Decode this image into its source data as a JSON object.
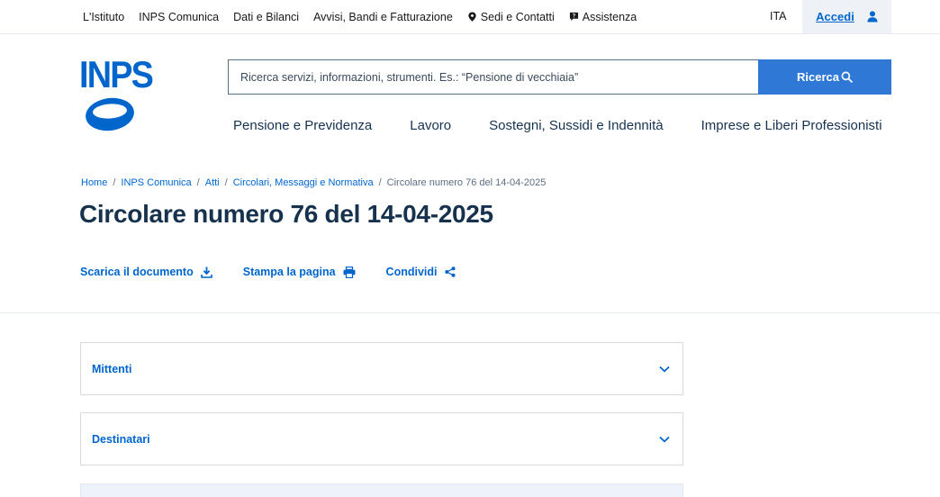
{
  "top_nav": {
    "items": [
      {
        "label": "L'Istituto"
      },
      {
        "label": "INPS Comunica"
      },
      {
        "label": "Dati e Bilanci"
      },
      {
        "label": "Avvisi, Bandi e Fatturazione"
      },
      {
        "label": "Sedi e Contatti",
        "icon": "map-pin-icon"
      },
      {
        "label": "Assistenza",
        "icon": "chat-help-icon"
      }
    ],
    "language": "ITA",
    "login_label": "Accedi",
    "login_icon": "user-icon"
  },
  "header": {
    "logo_text": "INPS",
    "search": {
      "placeholder": "Ricerca servizi, informazioni, strumenti. Es.: “Pensione di vecchiaia”",
      "button_label": "Ricerca",
      "button_icon": "search-icon"
    },
    "main_nav": [
      {
        "label": "Pensione e Previdenza"
      },
      {
        "label": "Lavoro"
      },
      {
        "label": "Sostegni, Sussidi e Indennità"
      },
      {
        "label": "Imprese e Liberi Professionisti"
      }
    ]
  },
  "breadcrumb": {
    "items": [
      {
        "label": "Home"
      },
      {
        "label": "INPS Comunica"
      },
      {
        "label": "Atti"
      },
      {
        "label": "Circolari, Messaggi e Normativa"
      }
    ],
    "current": "Circolare numero 76 del 14-04-2025"
  },
  "page": {
    "title": "Circolare numero 76 del 14-04-2025",
    "actions": [
      {
        "label": "Scarica il documento",
        "icon": "download-icon"
      },
      {
        "label": "Stampa la pagina",
        "icon": "print-icon"
      },
      {
        "label": "Condividi",
        "icon": "share-icon"
      }
    ],
    "accordions": [
      {
        "label": "Mittenti"
      },
      {
        "label": "Destinatari"
      }
    ]
  },
  "colors": {
    "primary": "#0066cc",
    "button": "#2f78d6",
    "text_dark": "#17324d"
  }
}
